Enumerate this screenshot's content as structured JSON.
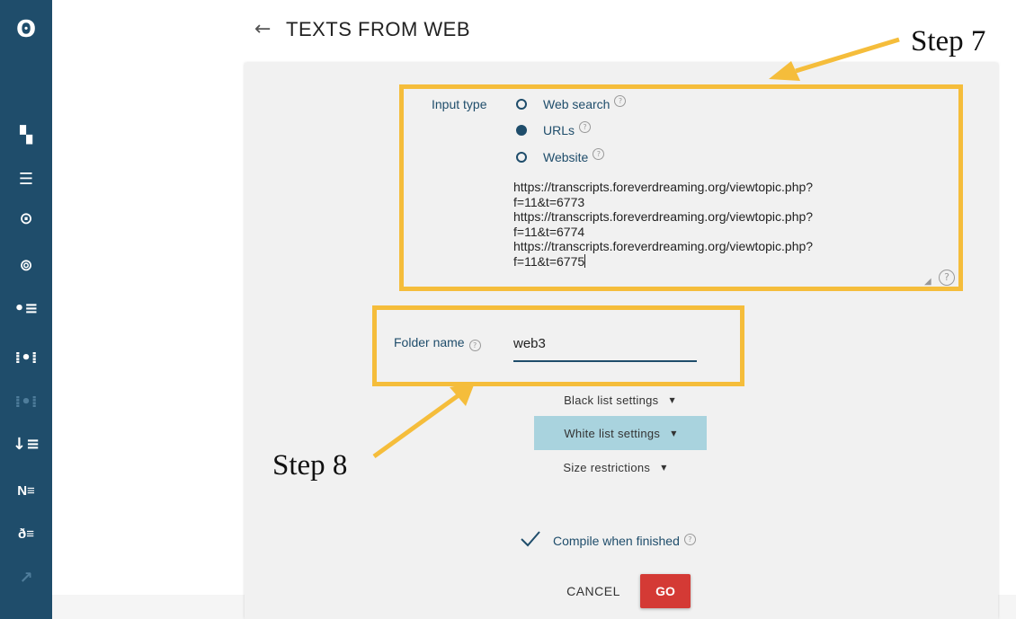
{
  "sidebar": {
    "items": [
      {
        "name": "logo-icon",
        "glyph": "ʘ"
      },
      {
        "name": "dashboard-icon",
        "glyph": "▚"
      },
      {
        "name": "list-icon",
        "glyph": "☰"
      },
      {
        "name": "target-icon",
        "glyph": "⊙"
      },
      {
        "name": "compare-icon",
        "glyph": "⊚"
      },
      {
        "name": "bullet-list-icon",
        "glyph": "•≡"
      },
      {
        "name": "concordance-icon",
        "glyph": "⁞•⁞"
      },
      {
        "name": "concordance-dim-icon",
        "glyph": "⁞•⁞"
      },
      {
        "name": "sort-list-icon",
        "glyph": "↓≡"
      },
      {
        "name": "ngram-icon",
        "glyph": "N≡"
      },
      {
        "name": "keyword-icon",
        "glyph": "ð≡"
      },
      {
        "name": "trend-icon",
        "glyph": "↗"
      }
    ]
  },
  "header": {
    "back_icon": "←",
    "title": "TEXTS FROM WEB"
  },
  "form": {
    "input_type_label": "Input type",
    "radio_options": [
      {
        "label": "Web search",
        "checked": false
      },
      {
        "label": "URLs",
        "checked": true
      },
      {
        "label": "Website",
        "checked": false
      }
    ],
    "help_glyph": "?",
    "urls_lines": [
      "https://transcripts.foreverdreaming.org/viewtopic.php?",
      "f=11&t=6773",
      "https://transcripts.foreverdreaming.org/viewtopic.php?",
      "f=11&t=6774",
      "https://transcripts.foreverdreaming.org/viewtopic.php?",
      "f=11&t=6775"
    ],
    "folder_name_label": "Folder name",
    "folder_name_value": "web3",
    "black_list_label": "Black list settings",
    "white_list_label": "White list settings",
    "size_restrictions_label": "Size restrictions",
    "dropdown_arrow": "▼",
    "compile_label": "Compile when finished",
    "compile_checked": true,
    "cancel_label": "CANCEL",
    "go_label": "GO"
  },
  "annotations": {
    "step7": "Step 7",
    "step8": "Step 8",
    "highlight_color": "#f5bd3b"
  },
  "colors": {
    "sidebar_bg": "#1f4d6b",
    "accent": "#1f4d6b",
    "go_button": "#d43a35",
    "active_dropdown": "#a9d3de"
  }
}
